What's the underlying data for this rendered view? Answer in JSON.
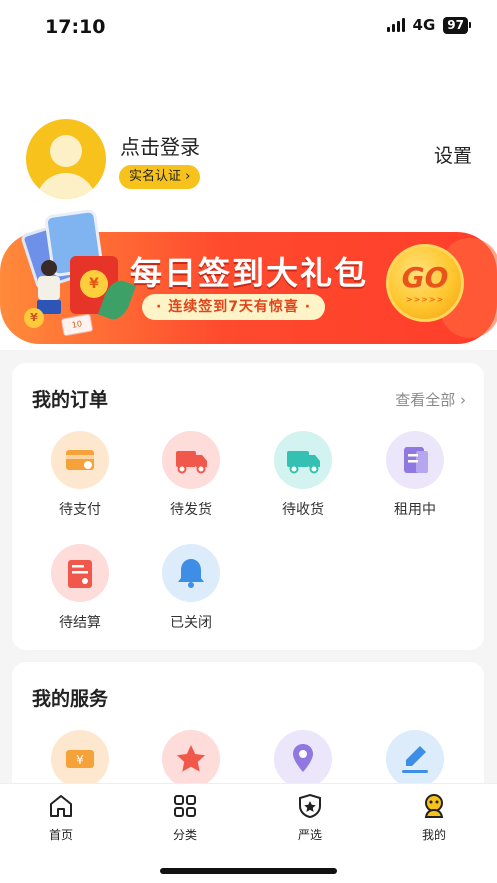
{
  "status_bar": {
    "time": "17:10",
    "network": "4G",
    "battery": "97"
  },
  "profile": {
    "login_text": "点击登录",
    "verify_label": "实名认证",
    "verify_chevron": "›",
    "settings_label": "设置"
  },
  "banner": {
    "title": "每日签到大礼包",
    "subtitle": "· 连续签到7天有惊喜 ·",
    "go_label": "GO",
    "go_arrows": ">>>>>"
  },
  "orders": {
    "title": "我的订单",
    "view_all": "查看全部",
    "view_all_chevron": "›",
    "items": [
      {
        "label": "待支付",
        "icon": "card-icon",
        "bg": "#fde8cf",
        "fg": "#f5a23a"
      },
      {
        "label": "待发货",
        "icon": "truck-icon",
        "bg": "#fddcd9",
        "fg": "#f0584c"
      },
      {
        "label": "待收货",
        "icon": "delivery-truck-icon",
        "bg": "#d2f3ef",
        "fg": "#34c0b2"
      },
      {
        "label": "租用中",
        "icon": "document-icon",
        "bg": "#ece6fb",
        "fg": "#8f78e0"
      },
      {
        "label": "待结算",
        "icon": "bill-icon",
        "bg": "#fddcd9",
        "fg": "#f0584c"
      },
      {
        "label": "已关闭",
        "icon": "bell-icon",
        "bg": "#dcecfb",
        "fg": "#3e8ee6"
      }
    ]
  },
  "services": {
    "title": "我的服务",
    "items": [
      {
        "icon": "ticket-icon",
        "bg": "#fde8cf",
        "fg": "#f5a23a"
      },
      {
        "icon": "star-icon",
        "bg": "#fddcd9",
        "fg": "#f0584c"
      },
      {
        "icon": "location-pin-icon",
        "bg": "#ece6fb",
        "fg": "#8f78e0"
      },
      {
        "icon": "edit-pen-icon",
        "bg": "#dcecfb",
        "fg": "#3e8ee6"
      }
    ]
  },
  "tabbar": [
    {
      "label": "首页",
      "icon": "home-icon"
    },
    {
      "label": "分类",
      "icon": "category-grid-icon"
    },
    {
      "label": "严选",
      "icon": "shield-star-icon"
    },
    {
      "label": "我的",
      "icon": "profile-mascot-icon",
      "active": true
    }
  ],
  "colors": {
    "accent": "#f7c21b",
    "banner_red": "#ff4a2e",
    "page_bg": "#f5f5f5"
  }
}
